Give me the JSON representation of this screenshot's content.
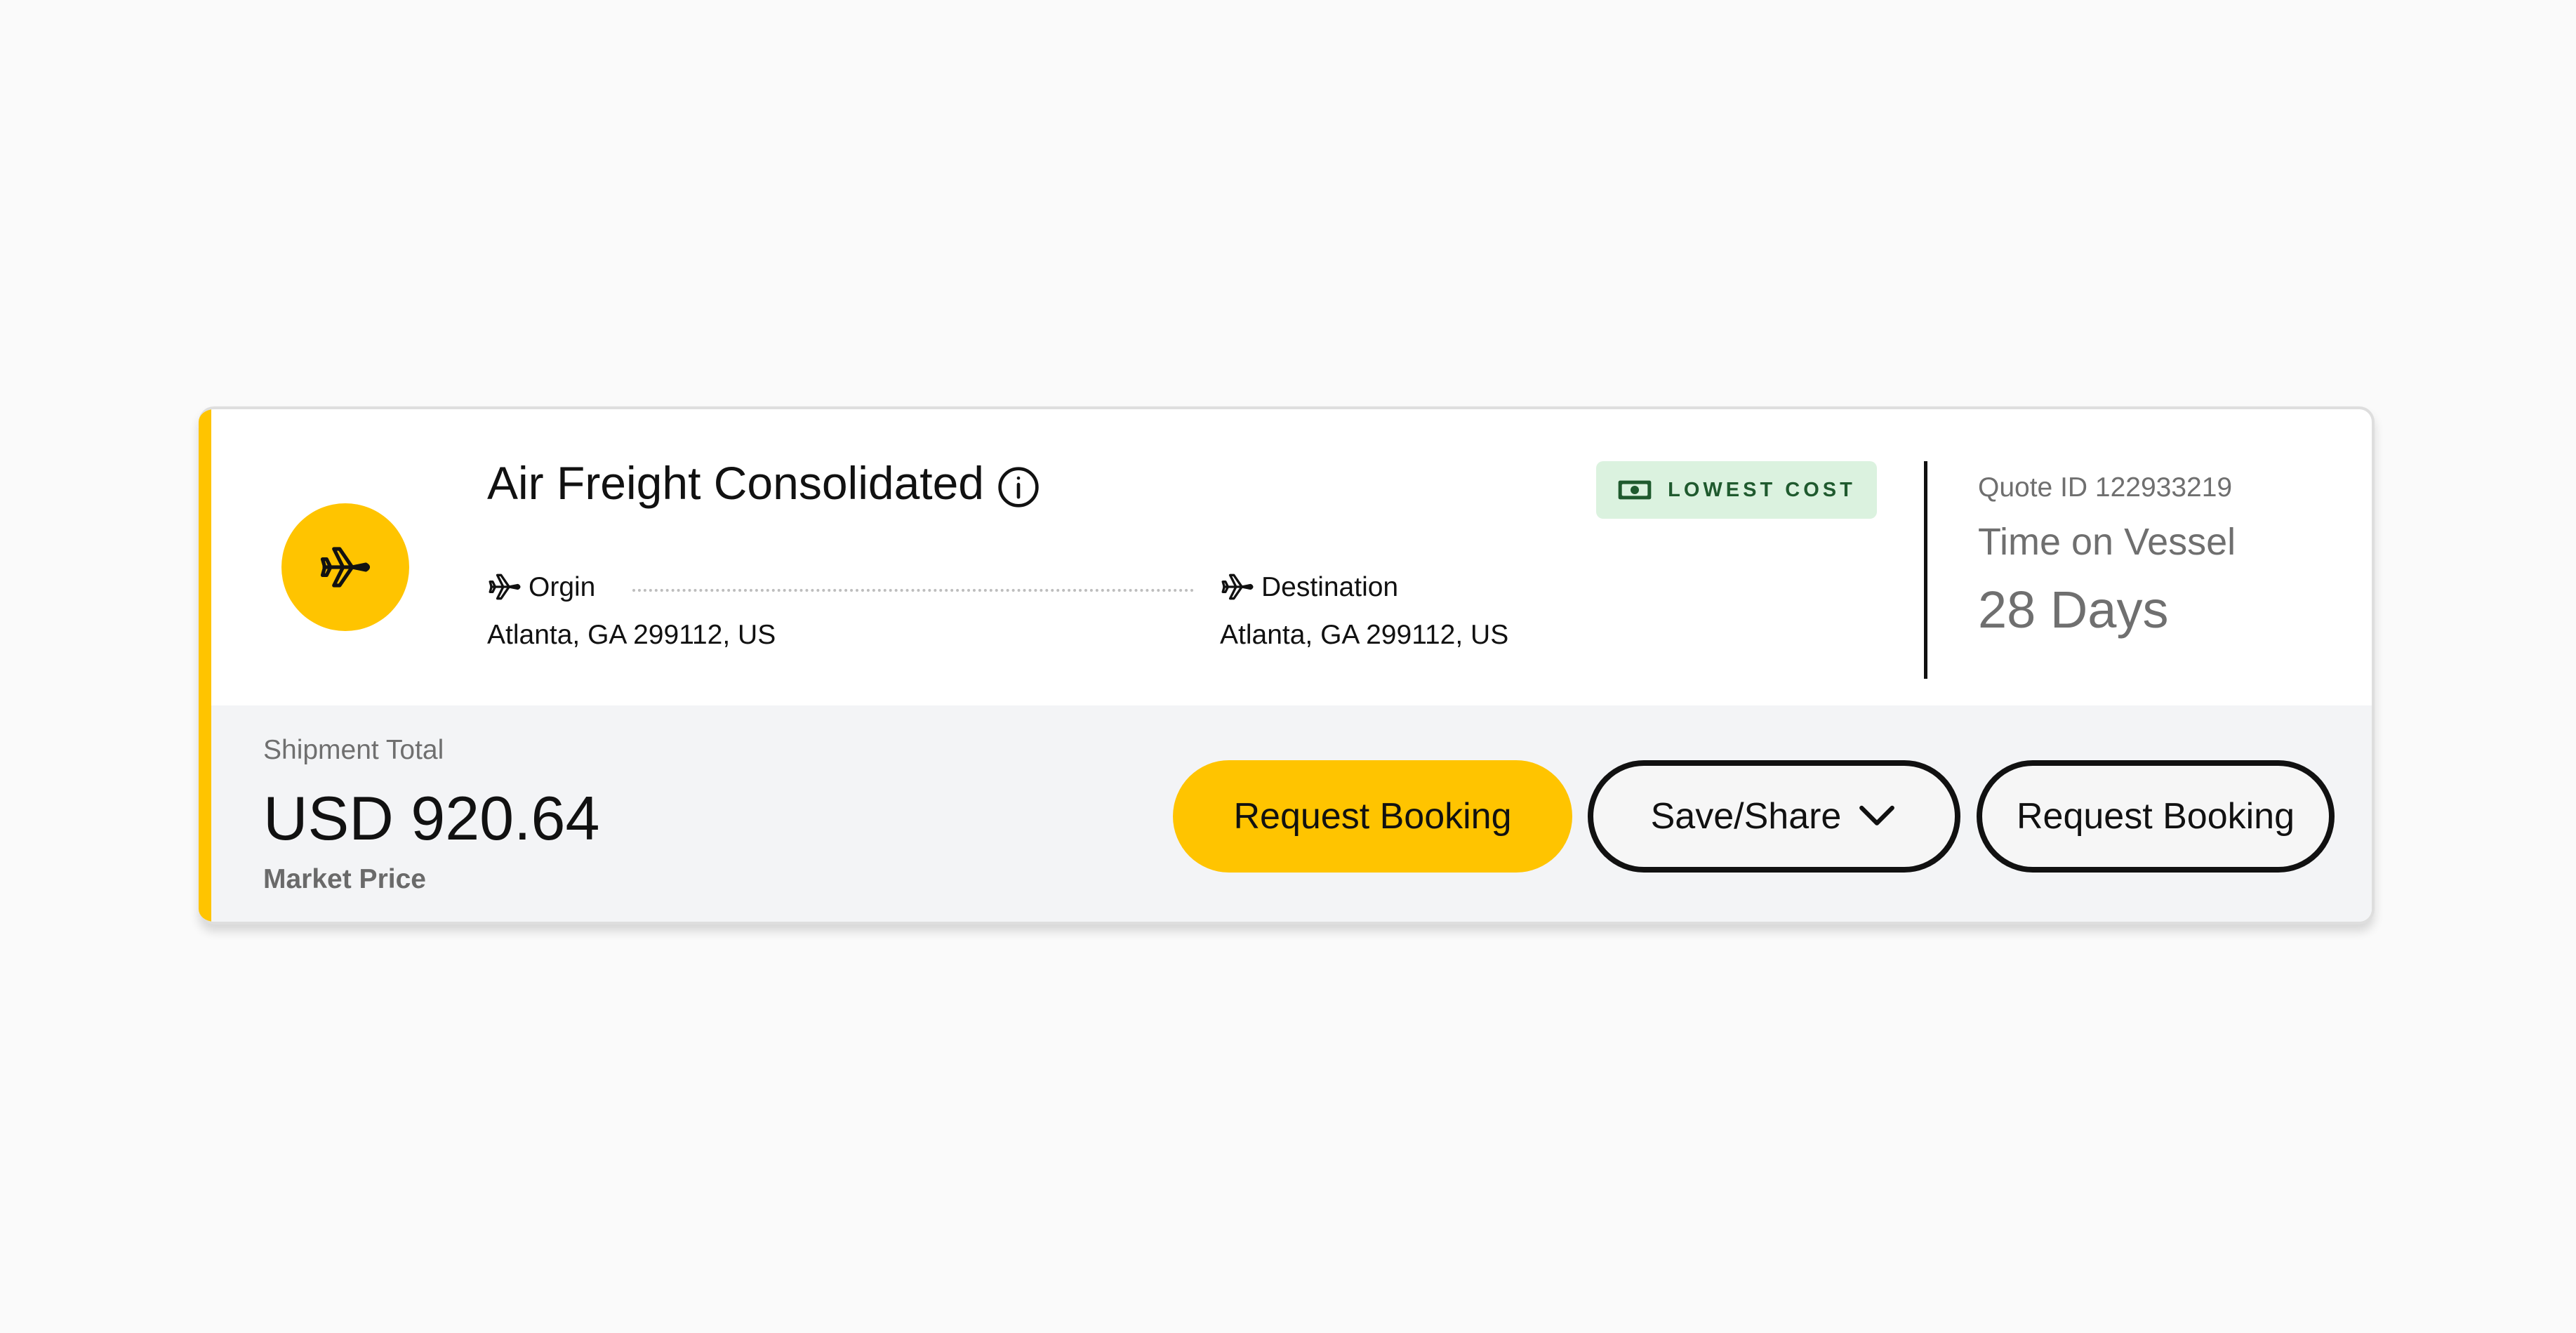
{
  "card": {
    "mode_icon": "airplane-icon",
    "title": "Air Freight Consolidated",
    "info_icon": "info-icon",
    "badge": {
      "icon": "cash-icon",
      "label": "LOWEST COST"
    },
    "origin": {
      "icon": "airplane-icon",
      "label": "Orgin",
      "address": "Atlanta, GA 299112, US"
    },
    "destination": {
      "icon": "airplane-icon",
      "label": "Destination",
      "address": "Atlanta, GA 299112, US"
    },
    "quote_id": "Quote ID 122933219",
    "time_on_vessel_label": "Time on Vessel",
    "time_on_vessel_value": "28 Days"
  },
  "footer": {
    "shipment_total_label": "Shipment Total",
    "shipment_total_value": "USD 920.64",
    "market_price_label": "Market Price",
    "buttons": {
      "request_booking_primary": "Request Booking",
      "save_share": "Save/Share",
      "request_booking_secondary": "Request Booking"
    }
  },
  "colors": {
    "accent": "#ffc400",
    "badge_bg": "#dbf2df",
    "badge_text": "#1f5a2e",
    "footer_bg": "#f3f4f6",
    "muted_text": "#6f6f6f"
  }
}
